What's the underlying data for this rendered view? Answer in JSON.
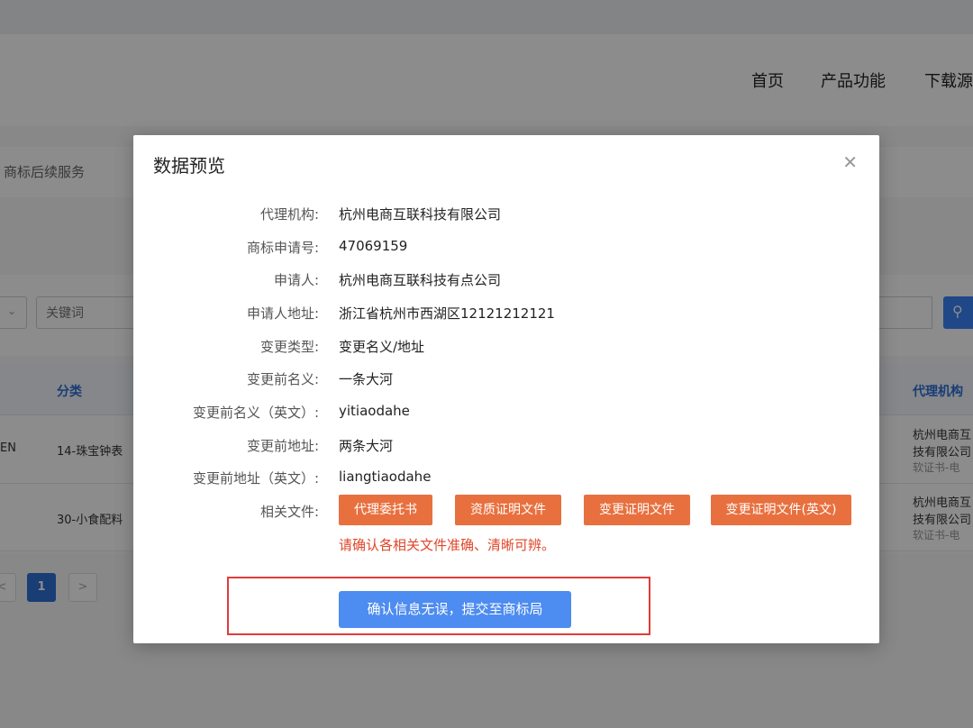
{
  "background": {
    "nav": [
      "首页",
      "产品功能",
      "下载源"
    ],
    "subnav_label": "商标后续服务",
    "filter": {
      "keyword_placeholder": "关键词"
    },
    "table": {
      "headers": [
        "分类",
        "代理机构"
      ],
      "rows": [
        {
          "prefix": "EN",
          "category": "14-珠宝钟表",
          "agency_line1": "杭州电商互",
          "agency_line2": "技有限公司",
          "agency_line3": "软证书-电"
        },
        {
          "prefix": "",
          "category": "30-小食配料",
          "agency_line1": "杭州电商互",
          "agency_line2": "技有限公司",
          "agency_line3": "软证书-电"
        }
      ]
    },
    "pagination": {
      "prev": "<",
      "current": "1",
      "next": ">"
    }
  },
  "modal": {
    "title": "数据预览",
    "close_icon": "close-icon",
    "fields": [
      {
        "label": "代理机构:",
        "value": "杭州电商互联科技有限公司"
      },
      {
        "label": "商标申请号:",
        "value": "47069159"
      },
      {
        "label": "申请人:",
        "value": "杭州电商互联科技有点公司"
      },
      {
        "label": "申请人地址:",
        "value": "浙江省杭州市西湖区12121212121"
      },
      {
        "label": "变更类型:",
        "value": "变更名义/地址"
      },
      {
        "label": "变更前名义:",
        "value": "一条大河"
      },
      {
        "label": "变更前名义（英文）:",
        "value": "yitiaodahe"
      },
      {
        "label": "变更前地址:",
        "value": "两条大河"
      },
      {
        "label": "变更前地址（英文）:",
        "value": "liangtiaodahe"
      }
    ],
    "files_label": "相关文件:",
    "file_buttons": [
      "代理委托书",
      "资质证明文件",
      "变更证明文件",
      "变更证明文件(英文)"
    ],
    "warning": "请确认各相关文件准确、清晰可辨。",
    "submit_label": "确认信息无误，提交至商标局",
    "colors": {
      "accent_orange": "#e8703f",
      "primary_blue": "#4d8cf0",
      "warning_red": "#e0462a",
      "highlight_red": "#e23b3b"
    }
  }
}
